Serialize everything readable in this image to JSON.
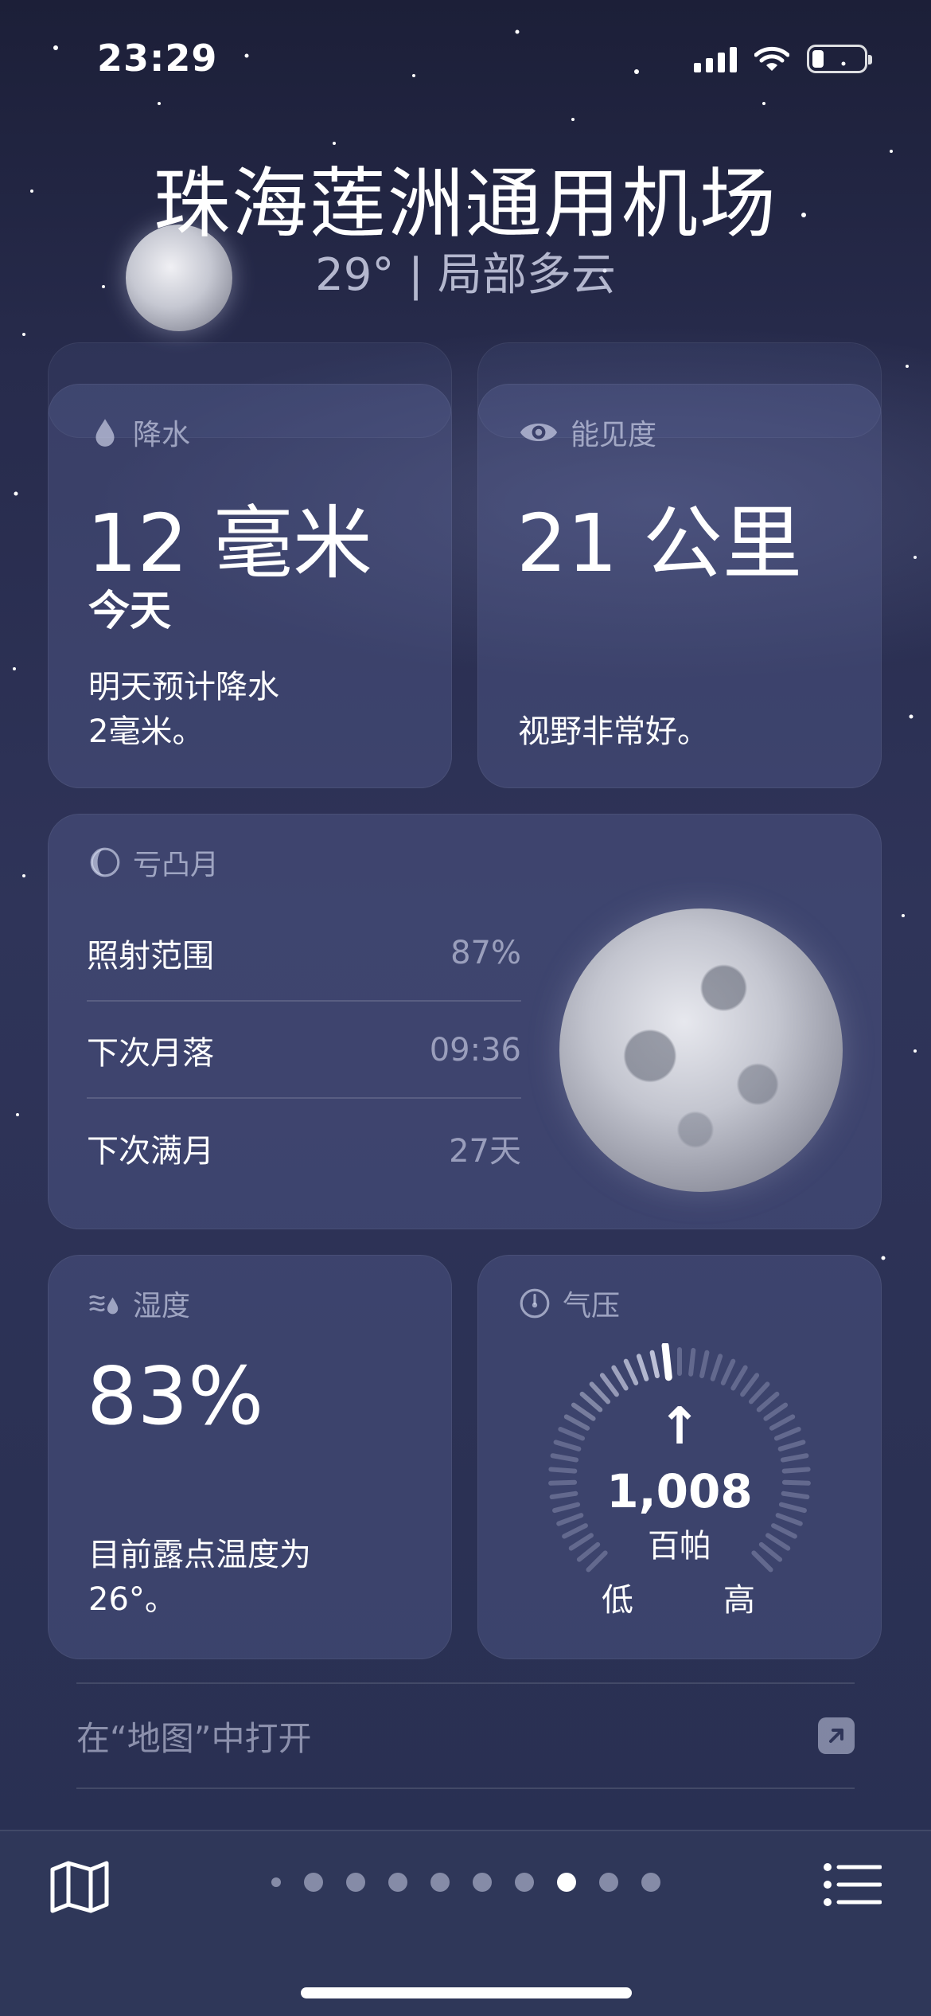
{
  "status_bar": {
    "time": "23:29"
  },
  "header": {
    "city": "珠海莲洲通用机场",
    "subtitle": "29° | 局部多云"
  },
  "cards": {
    "precipitation": {
      "title": "降水",
      "icon": "raindrop-icon",
      "value": "12 毫米",
      "period": "今天",
      "description": "明天预计降水\n2毫米。"
    },
    "visibility": {
      "title": "能见度",
      "icon": "eye-icon",
      "value": "21 公里",
      "description": "视野非常好。"
    },
    "moon": {
      "title": "亏凸月",
      "icon": "moon-phase-icon",
      "rows": [
        {
          "label": "照射范围",
          "value": "87%"
        },
        {
          "label": "下次月落",
          "value": "09:36"
        },
        {
          "label": "下次满月",
          "value": "27天"
        }
      ]
    },
    "humidity": {
      "title": "湿度",
      "icon": "humidity-icon",
      "value": "83%",
      "description": "目前露点温度为\n26°。"
    },
    "pressure": {
      "title": "气压",
      "icon": "gauge-icon",
      "trend": "↑",
      "value": "1,008",
      "unit": "百帕",
      "low_label": "低",
      "high_label": "高"
    }
  },
  "maps_link": {
    "label": "在“地图”中打开",
    "icon": "external-arrow-icon"
  },
  "bottom_bar": {
    "map_icon": "map-icon",
    "list_icon": "list-icon",
    "page_count": 10,
    "current_page": 8
  },
  "colors": {
    "background_top": "#1c1f38",
    "background_bottom": "#283052",
    "card": "#4a507f",
    "bottom_bar": "#2f3759"
  }
}
